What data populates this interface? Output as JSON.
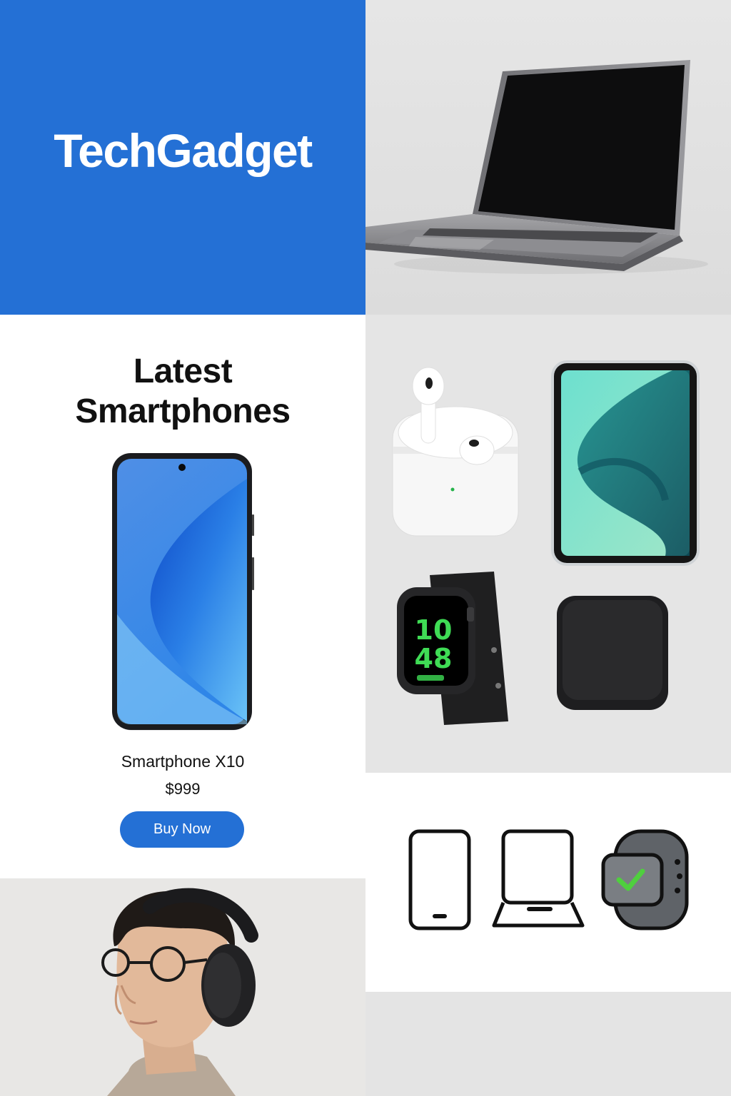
{
  "brand": {
    "name": "TechGadget",
    "background": "#2470D5"
  },
  "feature": {
    "title_line1": "Latest",
    "title_line2": "Smartphones",
    "product_name": "Smartphone X10",
    "price": "$999",
    "cta_label": "Buy Now",
    "accent": "#2470D5"
  },
  "accessories": {
    "watch_time_hour": "10",
    "watch_time_minute": "48",
    "items": [
      "earbuds-case",
      "tablet",
      "smartwatch",
      "square-pad"
    ]
  },
  "icons": [
    "smartphone-icon",
    "laptop-icon",
    "smartwatch-check-icon"
  ]
}
